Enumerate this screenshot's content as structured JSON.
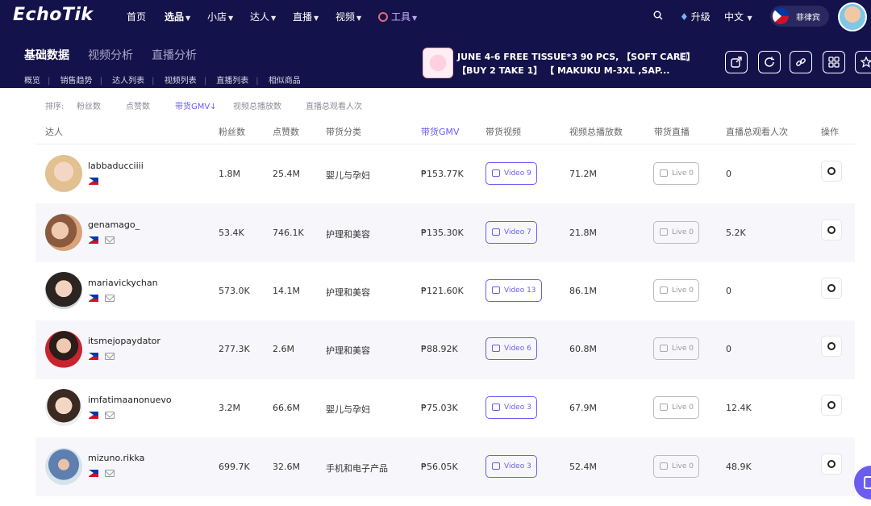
{
  "brand": {
    "logo": "EchoTik"
  },
  "topnav": {
    "items": [
      {
        "label": "首页"
      },
      {
        "label": "选品"
      },
      {
        "label": "小店"
      },
      {
        "label": "达人"
      },
      {
        "label": "直播"
      },
      {
        "label": "视频"
      },
      {
        "label": "工具"
      }
    ],
    "upgrade": "升级",
    "language": "中文",
    "country": "菲律宾"
  },
  "subnav": {
    "tabs": [
      {
        "label": "基础数据"
      },
      {
        "label": "视频分析"
      },
      {
        "label": "直播分析"
      }
    ],
    "links": [
      "概览",
      "销售趋势",
      "达人列表",
      "视频列表",
      "直播列表",
      "相似商品"
    ]
  },
  "product": {
    "title_line1": "JUNE 4-6 FREE TISSUE*3 90 PCS, 【SOFT CARE】",
    "title_line2": "【BUY 2 TAKE 1】 【 MAKUKU M-3XL ,SAP..."
  },
  "sortbar": {
    "label": "排序:",
    "options": [
      "粉丝数",
      "点赞数",
      "带货GMV↓",
      "视频总播放数",
      "直播总观看人次"
    ]
  },
  "table": {
    "headers": [
      "达人",
      "粉丝数",
      "点赞数",
      "带货分类",
      "带货GMV",
      "带货视频",
      "视频总播放数",
      "带货直播",
      "直播总观看人次",
      "操作"
    ],
    "rows": [
      {
        "name": "labbaducciiii",
        "followers": "1.8M",
        "likes": "25.4M",
        "category": "婴儿与孕妇",
        "gmv": "₱153.77K",
        "video": "Video 9",
        "plays": "71.2M",
        "live": "Live 0",
        "viewers": "0"
      },
      {
        "name": "genamago_",
        "followers": "53.4K",
        "likes": "746.1K",
        "category": "护理和美容",
        "gmv": "₱135.30K",
        "video": "Video 7",
        "plays": "21.8M",
        "live": "Live 0",
        "viewers": "5.2K"
      },
      {
        "name": "mariavickychan",
        "followers": "573.0K",
        "likes": "14.1M",
        "category": "护理和美容",
        "gmv": "₱121.60K",
        "video": "Video 13",
        "plays": "86.1M",
        "live": "Live 0",
        "viewers": "0"
      },
      {
        "name": "itsmejopaydator",
        "followers": "277.3K",
        "likes": "2.6M",
        "category": "护理和美容",
        "gmv": "₱88.92K",
        "video": "Video 6",
        "plays": "60.8M",
        "live": "Live 0",
        "viewers": "0"
      },
      {
        "name": "imfatimaanonuevo",
        "followers": "3.2M",
        "likes": "66.6M",
        "category": "婴儿与孕妇",
        "gmv": "₱75.03K",
        "video": "Video 3",
        "plays": "67.9M",
        "live": "Live 0",
        "viewers": "12.4K"
      },
      {
        "name": "mizuno.rikka",
        "followers": "699.7K",
        "likes": "32.6M",
        "category": "手机和电子产品",
        "gmv": "₱56.05K",
        "video": "Video 3",
        "plays": "52.4M",
        "live": "Live 0",
        "viewers": "48.9K"
      }
    ]
  },
  "colors": {
    "nav_bg": "#14124a",
    "accent": "#6a5cf0"
  }
}
